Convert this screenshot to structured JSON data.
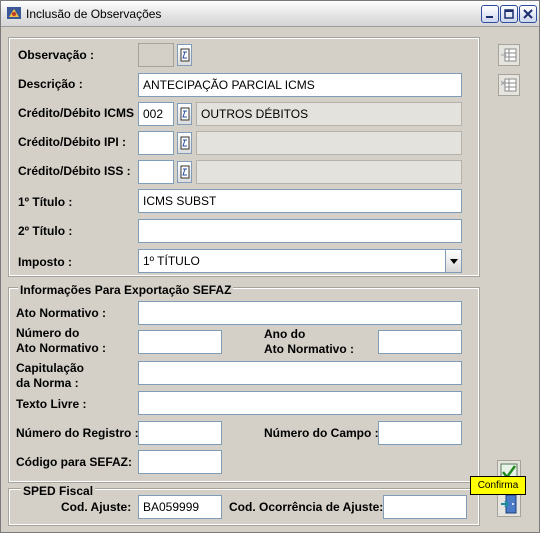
{
  "window": {
    "title": "Inclusão de Observações"
  },
  "form": {
    "observacao_label": "Observação :",
    "descricao_label": "Descrição :",
    "descricao_value": "ANTECIPAÇÃO PARCIAL ICMS",
    "cd_icms_label": "Crédito/Débito ICMS :",
    "cd_icms_code": "002",
    "cd_icms_desc": "OUTROS DÉBITOS",
    "cd_ipi_label": "Crédito/Débito IPI :",
    "cd_iss_label": "Crédito/Débito ISS :",
    "titulo1_label": "1º Título :",
    "titulo1_value": "ICMS SUBST",
    "titulo2_label": "2º Título :",
    "imposto_label": "Imposto :",
    "imposto_value": "1º TÍTULO"
  },
  "sefaz": {
    "section_title": "Informações Para Exportação SEFAZ",
    "ato_normativo_label": "Ato Normativo :",
    "numero_ato_label_1": "Número do",
    "numero_ato_label_2": "Ato Normativo :",
    "ano_ato_label_1": "Ano do",
    "ano_ato_label_2": "Ato Normativo :",
    "capitulacao_label_1": "Capitulação",
    "capitulacao_label_2": "da Norma :",
    "texto_livre_label": "Texto Livre :",
    "numero_registro_label": "Número do Registro :",
    "numero_campo_label": "Número do Campo :",
    "codigo_sefaz_label": "Código para SEFAZ:"
  },
  "sped": {
    "section_title": "SPED Fiscal",
    "cod_ajuste_label": "Cod. Ajuste:",
    "cod_ajuste_value": "BA059999",
    "cod_ocorrencia_label": "Cod. Ocorrência de Ajuste:"
  },
  "tooltip": {
    "text": "Confirma"
  },
  "colors": {
    "window_bg": "#d4d0c8",
    "input_border": "#7f9db9",
    "tooltip_bg": "#ffff00"
  }
}
